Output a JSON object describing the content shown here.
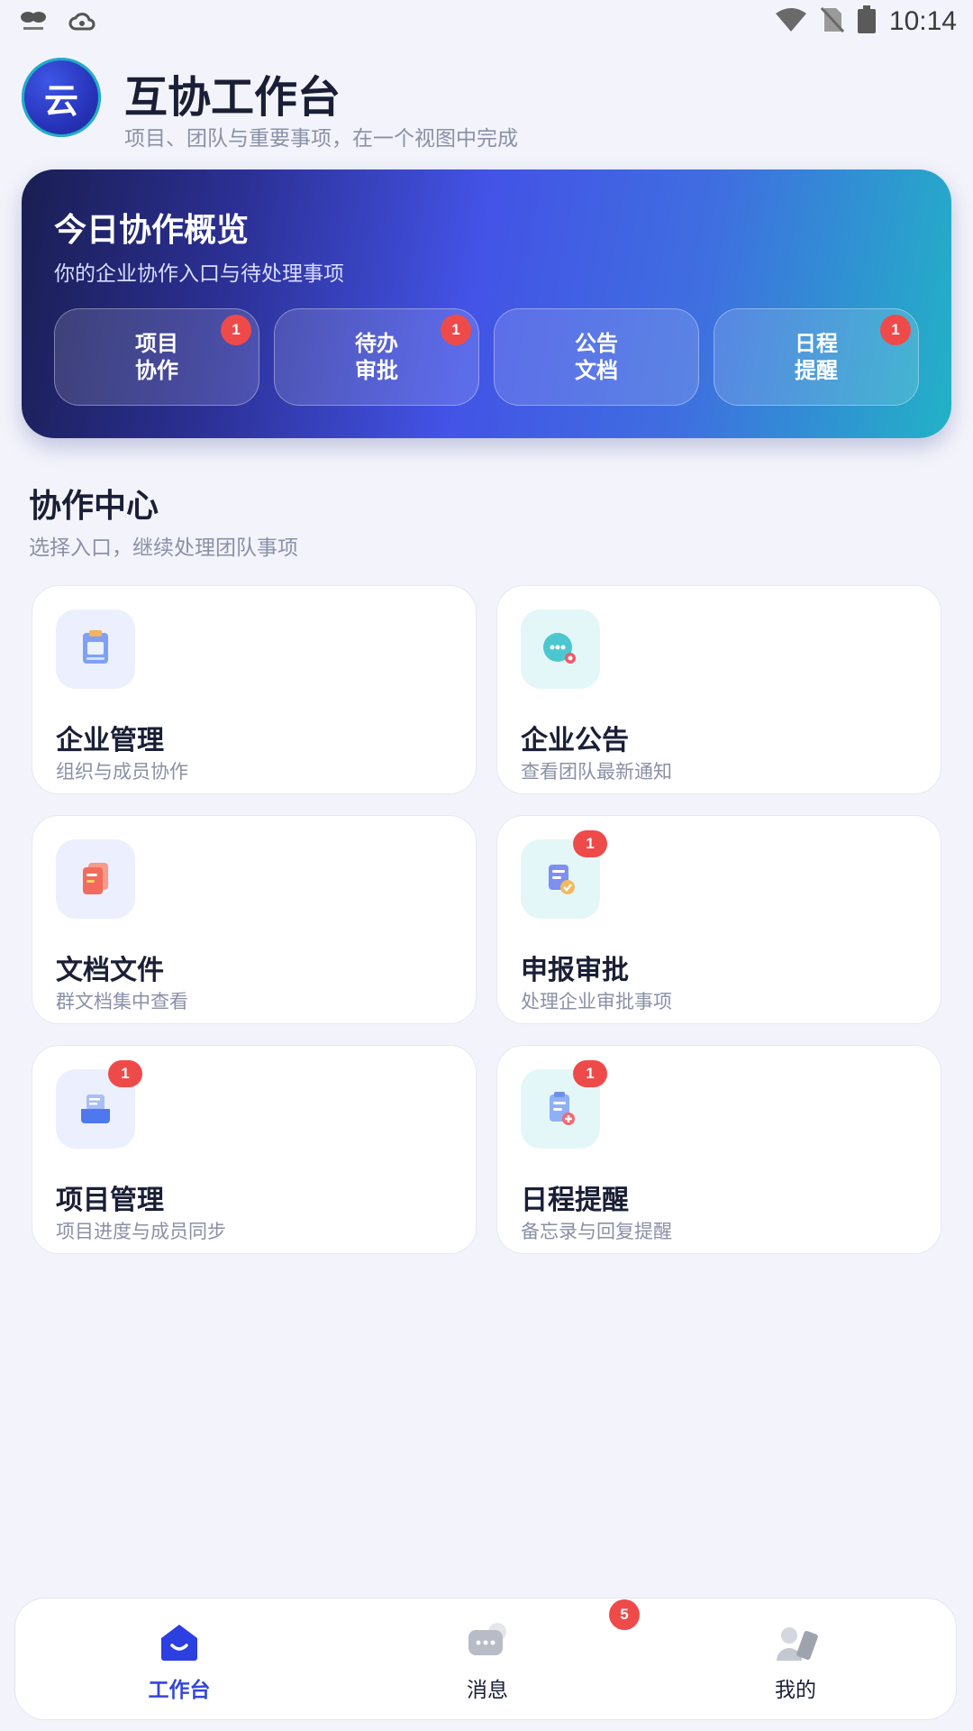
{
  "status_bar": {
    "time": "10:14"
  },
  "header": {
    "logo_char": "云",
    "title": "互协工作台",
    "subtitle": "项目、团队与重要事项，在一个视图中完成"
  },
  "overview": {
    "title": "今日协作概览",
    "subtitle": "你的企业协作入口与待处理事项",
    "pills": [
      {
        "line1": "项目",
        "line2": "协作",
        "badge": "1"
      },
      {
        "line1": "待办",
        "line2": "审批",
        "badge": "1"
      },
      {
        "line1": "公告",
        "line2": "文档",
        "badge": ""
      },
      {
        "line1": "日程",
        "line2": "提醒",
        "badge": "1"
      }
    ]
  },
  "section": {
    "title": "协作中心",
    "subtitle": "选择入口，继续处理团队事项"
  },
  "cards": [
    {
      "title": "企业管理",
      "subtitle": "组织与成员协作",
      "icon": "clipboard-icon",
      "badge": ""
    },
    {
      "title": "企业公告",
      "subtitle": "查看团队最新通知",
      "icon": "chat-bubble-icon",
      "badge": ""
    },
    {
      "title": "文档文件",
      "subtitle": "群文档集中查看",
      "icon": "document-icon",
      "badge": ""
    },
    {
      "title": "申报审批",
      "subtitle": "处理企业审批事项",
      "icon": "approval-icon",
      "badge": "1"
    },
    {
      "title": "项目管理",
      "subtitle": "项目进度与成员同步",
      "icon": "inbox-icon",
      "badge": "1"
    },
    {
      "title": "日程提醒",
      "subtitle": "备忘录与回复提醒",
      "icon": "memo-icon",
      "badge": "1"
    }
  ],
  "bottom_nav": {
    "items": [
      {
        "label": "工作台",
        "icon": "home-icon",
        "active": true
      },
      {
        "label": "消息",
        "icon": "message-icon",
        "active": false
      },
      {
        "label": "我的",
        "icon": "user-icon",
        "active": false
      }
    ],
    "message_badge": "5"
  },
  "colors": {
    "accent": "#3446d8",
    "badge": "#ef4a4a",
    "background": "#f3f4fb"
  }
}
